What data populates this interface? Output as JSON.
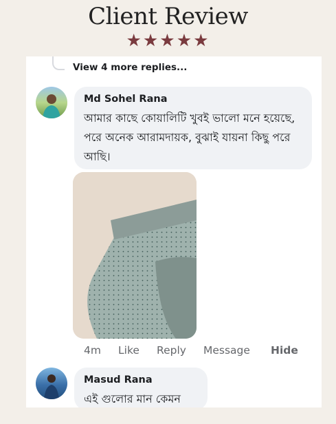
{
  "header": {
    "title": "Client Review",
    "stars": "★★★★★"
  },
  "thread": {
    "more_replies": "View 4 more replies..."
  },
  "comment1": {
    "author": "Md Sohel Rana",
    "text": "আমার কাছে কোয়ালিটি খুবই ভালো মনে হয়েছে, পরে অনেক আরামদায়ক,  বুঝাই যায়না কিছু পরে আছি।",
    "time": "4m",
    "like": "Like",
    "reply": "Reply",
    "message": "Message",
    "hide": "Hide"
  },
  "comment2": {
    "author": "Masud Rana",
    "text": "এই গুলোর মান কেমন"
  },
  "colors": {
    "background": "#f3efe9",
    "stars": "#7a3b3f",
    "bubble": "#f0f2f5"
  }
}
